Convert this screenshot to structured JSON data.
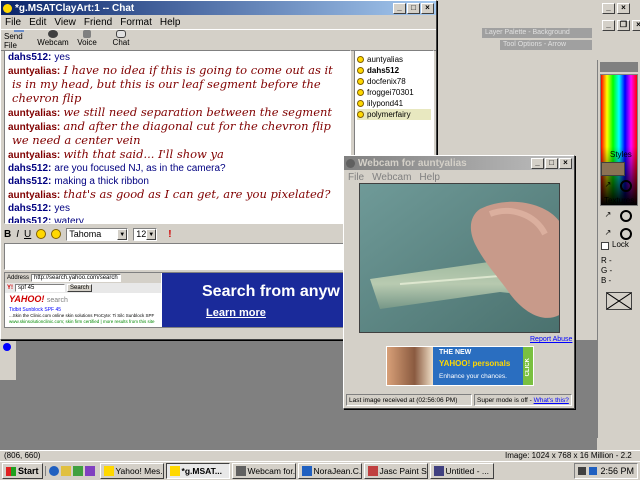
{
  "chat_window": {
    "title": "*g.MSATClayArt:1 -- Chat",
    "menu": [
      "File",
      "Edit",
      "View",
      "Friend",
      "Format",
      "Help"
    ],
    "toolbar": [
      "Send File",
      "Webcam",
      "Voice",
      "Chat"
    ],
    "messages": [
      {
        "nick": "dahs512:",
        "text": "yes",
        "style": "plain"
      },
      {
        "nick": "auntyalias:",
        "text": "I have no idea if this is going to come out as it",
        "style": "script"
      },
      {
        "nick": "",
        "text": "is in my head, but this is our leaf segment before the",
        "style": "script"
      },
      {
        "nick": "",
        "text": "chevron flip",
        "style": "script"
      },
      {
        "nick": "auntyalias:",
        "text": "we still need separation between the segment",
        "style": "script"
      },
      {
        "nick": "auntyalias:",
        "text": "and after the diagonal cut for the chevron flip",
        "style": "script"
      },
      {
        "nick": "",
        "text": "we need a center vein",
        "style": "script"
      },
      {
        "nick": "auntyalias:",
        "text": "with that said... I'll show ya",
        "style": "script"
      },
      {
        "nick": "dahs512:",
        "text": "are you focused NJ, as in the camera?",
        "style": "plain"
      },
      {
        "nick": "dahs512:",
        "text": "making a thick ribbon",
        "style": "plain"
      },
      {
        "nick": "auntyalias:",
        "text": "that's as good as I can get, are you pixelated?",
        "style": "script"
      },
      {
        "nick": "dahs512:",
        "text": "yes",
        "style": "plain"
      },
      {
        "nick": "dahs512:",
        "text": "watery",
        "style": "plain"
      }
    ],
    "participants": [
      "auntyalias",
      "dahs512",
      "docfenix78",
      "froggei70301",
      "lilypond41",
      "polymerfairy"
    ],
    "format": {
      "bold": "B",
      "italic": "I",
      "underline": "U",
      "font": "Tahoma",
      "size": "12"
    },
    "ad": {
      "address": "http://search.yahoo.com/search",
      "search_text": "spf 45",
      "search_btn": "Search",
      "brand": "YAHOO!",
      "brand_suffix": "search",
      "result_title": "Tidbit Sunblock SPF 45",
      "result_text": "...Skin the Clinic.com online skin solutions ProCyte: Ti Silc Sunblock SPF",
      "result_url": "www.skinsolutionclinic.com; skin firm certified | more results from this site",
      "banner_title": "Search from anyw",
      "banner_link": "Learn more",
      "address_label": "Address"
    }
  },
  "webcam_window": {
    "title": "Webcam for auntyalias",
    "menu": [
      "File",
      "Webcam",
      "Help"
    ],
    "report": "Report Abuse",
    "ad_line1": "THE NEW",
    "ad_line2": "YAHOO! personals",
    "ad_line3": "Enhance your chances.",
    "ad_click": "CLICK",
    "status_left": "Last image received at (02:56:06 PM)",
    "status_right": "Super mode is off - ",
    "status_link": "What's this?"
  },
  "paint_panels": {
    "layer_palette": "Layer Palette - Background",
    "tool_options": "Tool Options - Arrow",
    "styles_label": "Styles",
    "textures_label": "Textures",
    "lock_label": "Lock",
    "rgb": [
      "R -",
      "G -",
      "B -"
    ]
  },
  "statusbar": {
    "coords": "(806, 660)",
    "image_info": "Image:  1024 x 768 x 16 Million - 2.2 MBytes"
  },
  "taskbar": {
    "start": "Start",
    "tasks": [
      "Yahoo! Mes...",
      "*g.MSAT...",
      "Webcam for...",
      "NoraJean.C...",
      "Jasc Paint S...",
      "Untitled - ..."
    ],
    "active_index": 1,
    "clock": "2:56 PM"
  }
}
